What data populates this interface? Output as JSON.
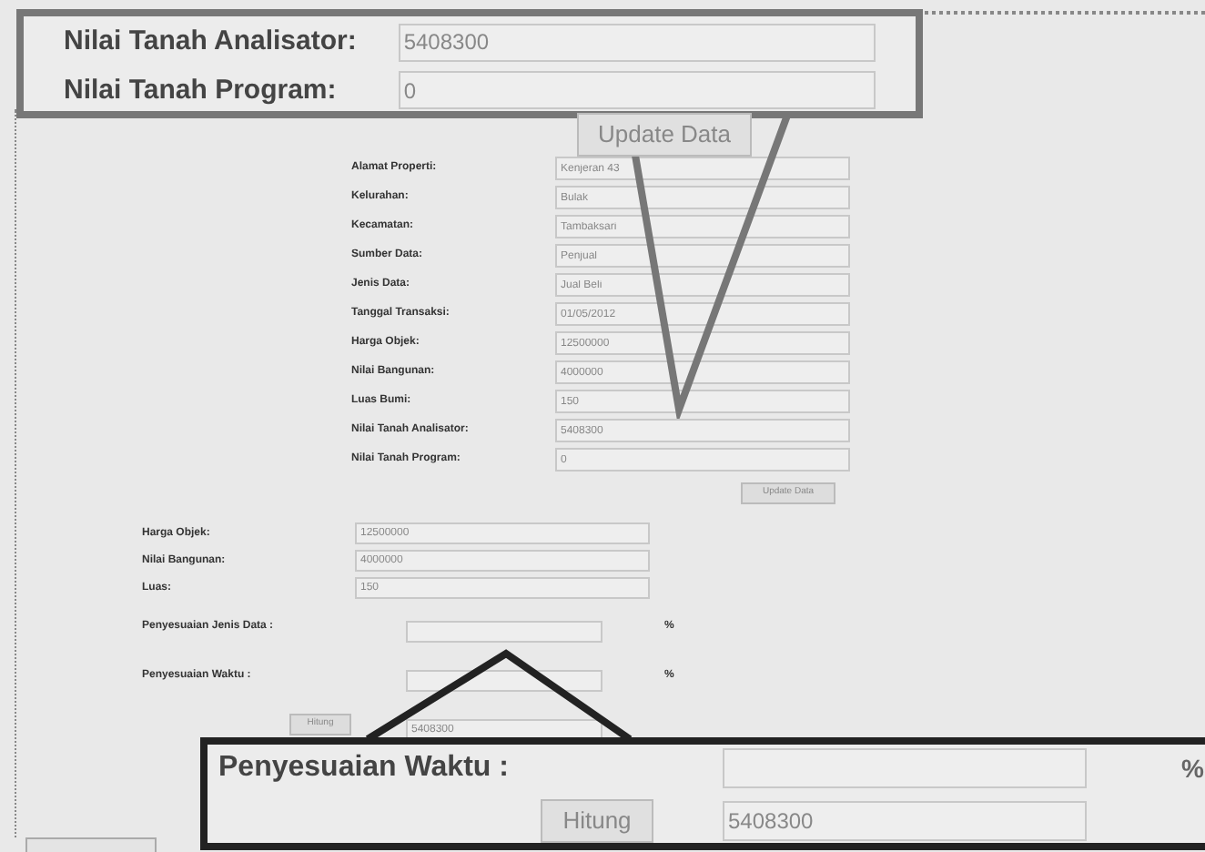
{
  "zoom_top": {
    "fields": [
      {
        "label": "Nilai Tanah Analisator:",
        "value": "5408300"
      },
      {
        "label": "Nilai Tanah Program:",
        "value": "0"
      }
    ],
    "button": "Update Data"
  },
  "form": {
    "fields": [
      {
        "label": "Alamat Properti:",
        "value": "Kenjeran 43"
      },
      {
        "label": "Kelurahan:",
        "value": "Bulak"
      },
      {
        "label": "Kecamatan:",
        "value": "Tambaksari"
      },
      {
        "label": "Sumber Data:",
        "value": "Penjual"
      },
      {
        "label": "Jenis Data:",
        "value": "Jual Beli"
      },
      {
        "label": "Tanggal Transaksi:",
        "value": "01/05/2012"
      },
      {
        "label": "Harga Objek:",
        "value": "12500000"
      },
      {
        "label": "Nilai Bangunan:",
        "value": "4000000"
      },
      {
        "label": "Luas Bumi:",
        "value": "150"
      },
      {
        "label": "Nilai Tanah Analisator:",
        "value": "5408300"
      },
      {
        "label": "Nilai Tanah Program:",
        "value": "0"
      }
    ],
    "button": "Update Data"
  },
  "adjustment": {
    "fields": [
      {
        "label": "Harga Objek:",
        "value": "12500000"
      },
      {
        "label": "Nilai Bangunan:",
        "value": "4000000"
      },
      {
        "label": "Luas:",
        "value": "150"
      }
    ],
    "percent_fields": [
      {
        "label": "Penyesuaian Jenis Data :",
        "unit": "%"
      },
      {
        "label": "Penyesuaian Waktu :",
        "unit": "%"
      }
    ],
    "button": "Hitung",
    "result": "5408300"
  },
  "zoom_bottom": {
    "label": "Penyesuaian Waktu :",
    "unit": "%",
    "button": "Hitung",
    "result": "5408300"
  }
}
